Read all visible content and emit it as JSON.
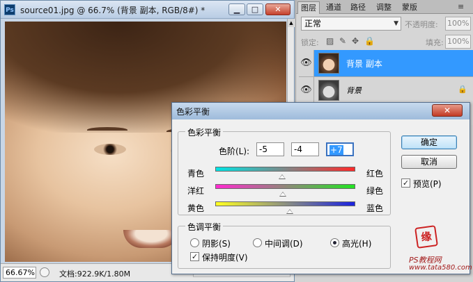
{
  "document": {
    "title": "source01.jpg @ 66.7% (背景 副本, RGB/8#) *",
    "app_icon": "Ps",
    "window_buttons": {
      "minimize": "▁",
      "maximize": "□",
      "close": "✕"
    },
    "status": {
      "zoom": "66.67%",
      "info": "文档:922.9K/1.80M",
      "menu_arrow": "▶"
    }
  },
  "layers_panel": {
    "tabs": [
      "图层",
      "通道",
      "路径",
      "调整",
      "蒙版"
    ],
    "menu_icon": "≡",
    "blend_mode": "正常",
    "dropdown_arrow": "▼",
    "opacity_label": "不透明度:",
    "opacity_value": "100%",
    "lock_label": "锁定:",
    "lock_icons": [
      "▨",
      "✎",
      "✥",
      "🔒"
    ],
    "fill_label": "填充:",
    "fill_value": "100%",
    "layers": [
      {
        "name": "背景 副本",
        "selected": true,
        "visible_glyph": "👁"
      },
      {
        "name": "背景",
        "selected": false,
        "visible_glyph": "👁",
        "lock_glyph": "🔒"
      }
    ]
  },
  "dialog": {
    "title": "色彩平衡",
    "close_glyph": "✕",
    "balance_group": {
      "legend": "色彩平衡",
      "levels_label": "色阶(L):",
      "levels": [
        "-5",
        "-4",
        "+7"
      ]
    },
    "sliders": [
      {
        "left": "青色",
        "right": "红色",
        "value": -5
      },
      {
        "left": "洋红",
        "right": "绿色",
        "value": -4
      },
      {
        "left": "黄色",
        "right": "蓝色",
        "value": 7
      }
    ],
    "slider_range": [
      -100,
      100
    ],
    "tone_group": {
      "legend": "色调平衡",
      "options": [
        "阴影(S)",
        "中间调(D)",
        "高光(H)"
      ],
      "selected_index": 2,
      "preserve_label": "保持明度(V)",
      "preserve_checked": true
    },
    "buttons": {
      "ok": "确定",
      "cancel": "取消"
    },
    "preview_label": "预览(P)",
    "preview_checked": true,
    "check_glyph": "✓"
  },
  "watermark": {
    "seal": "缘",
    "line1": "PS教程网",
    "line2": "www.tata580.com"
  },
  "colors": {
    "selection_blue": "#3399ff",
    "close_red": "#c23a25"
  }
}
